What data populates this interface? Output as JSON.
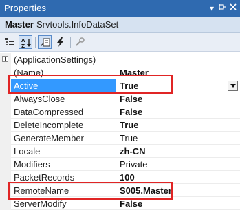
{
  "window": {
    "title": "Properties"
  },
  "selector": {
    "object_name": "Master",
    "object_type": "Srvtools.InfoDataSet"
  },
  "toolbar": {
    "buttons": [
      "categorized-icon",
      "alphabetical-icon",
      "properties-icon",
      "events-icon",
      "property-pages-icon"
    ]
  },
  "grid": {
    "category": "(ApplicationSettings)",
    "properties": [
      {
        "name": "(Name)",
        "value": "Master"
      },
      {
        "name": "Active",
        "value": "True"
      },
      {
        "name": "AlwaysClose",
        "value": "False"
      },
      {
        "name": "DataCompressed",
        "value": "False"
      },
      {
        "name": "DeleteIncomplete",
        "value": "True"
      },
      {
        "name": "GenerateMember",
        "value": "True"
      },
      {
        "name": "Locale",
        "value": "zh-CN"
      },
      {
        "name": "Modifiers",
        "value": "Private"
      },
      {
        "name": "PacketRecords",
        "value": "100"
      },
      {
        "name": "RemoteName",
        "value": "S005.Master"
      },
      {
        "name": "ServerModify",
        "value": "False"
      }
    ]
  },
  "colors": {
    "titlebar": "#2f6ab0",
    "selection": "#3399ff",
    "highlight_box": "#e02525"
  }
}
